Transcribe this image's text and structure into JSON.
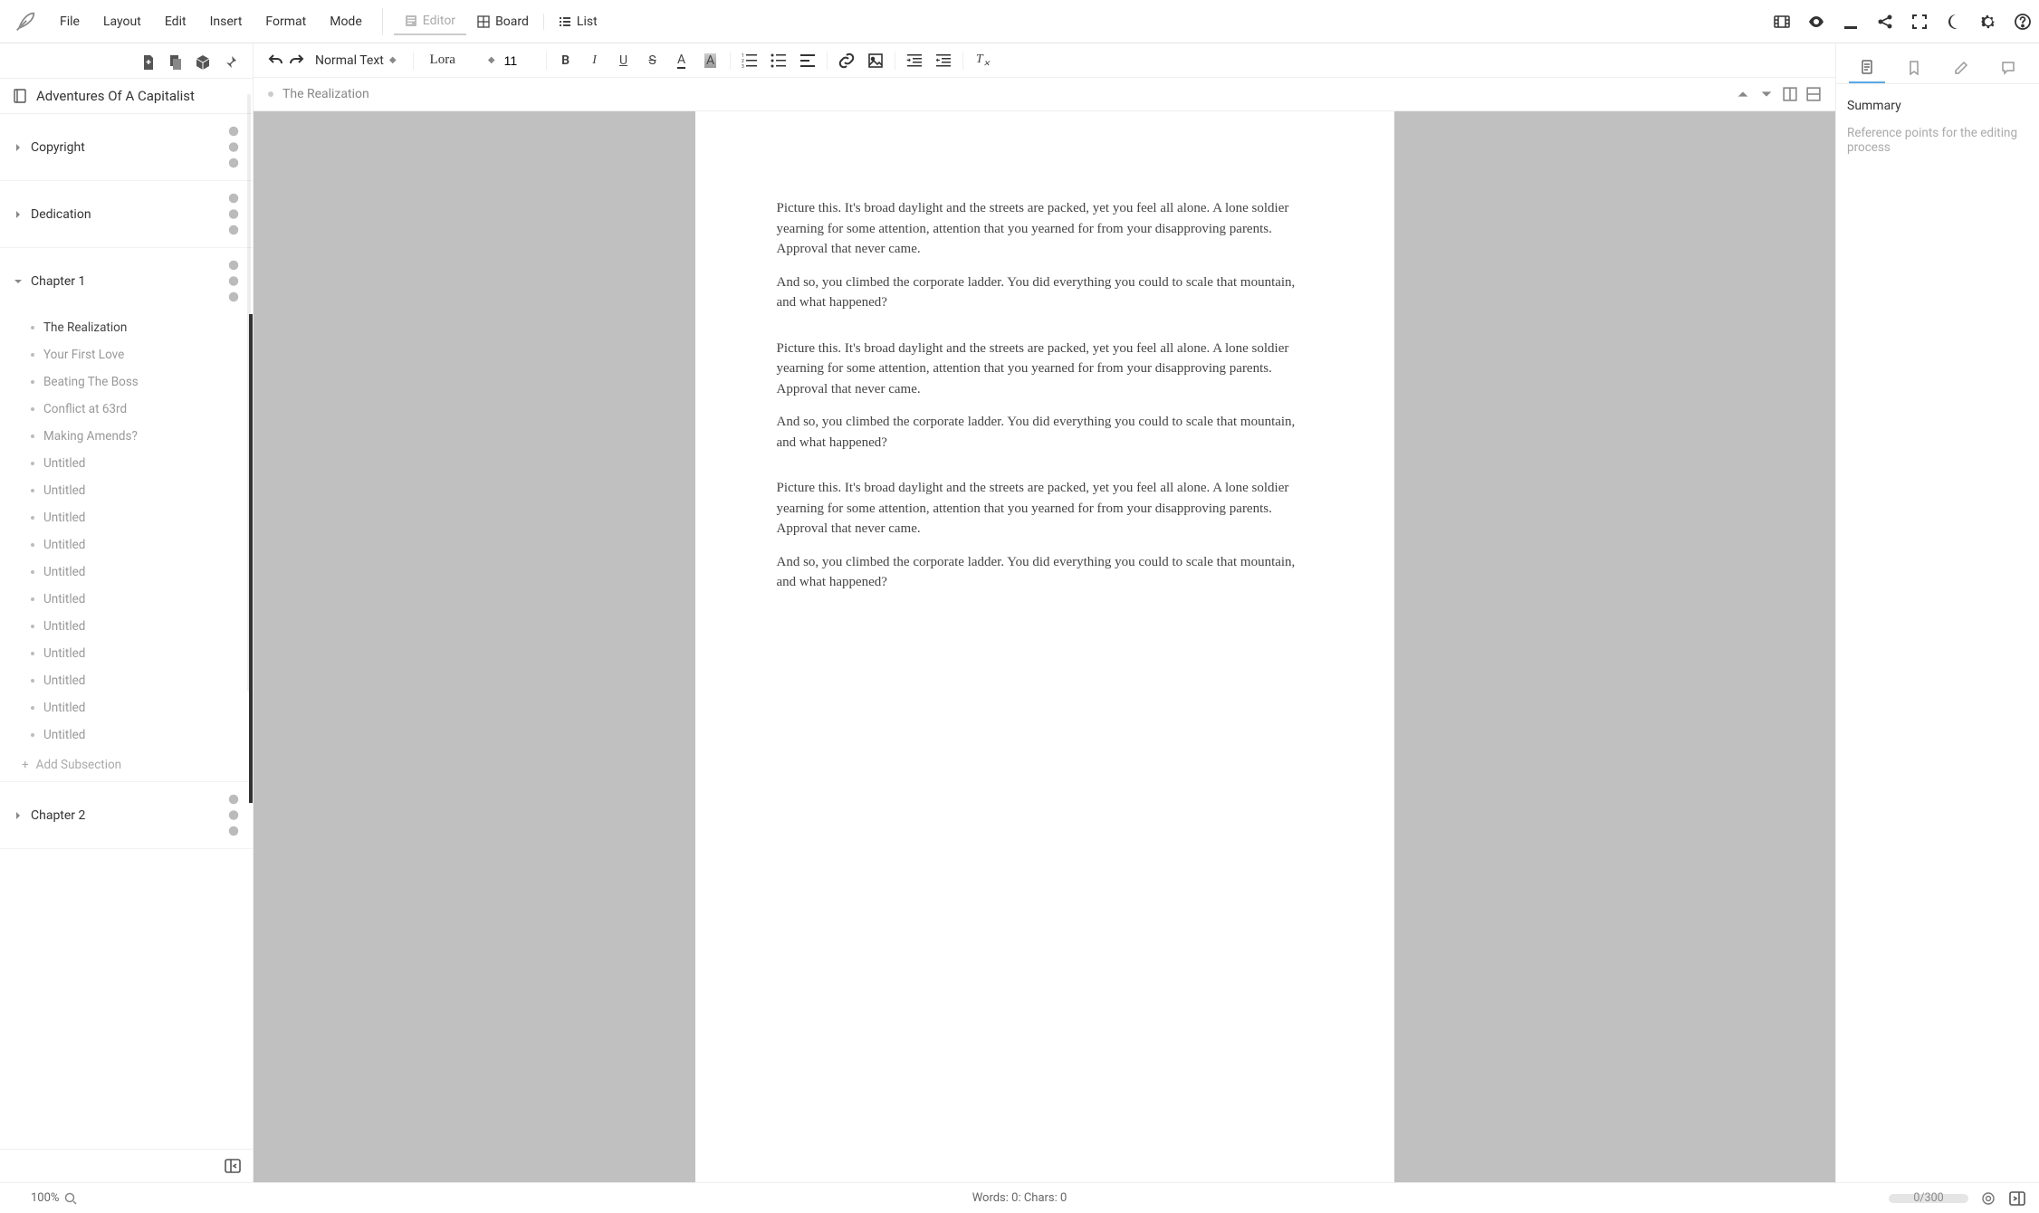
{
  "menu": {
    "items": [
      "File",
      "Layout",
      "Edit",
      "Insert",
      "Format",
      "Mode"
    ]
  },
  "view_tabs": [
    {
      "label": "Editor",
      "active": true
    },
    {
      "label": "Board",
      "active": false
    },
    {
      "label": "List",
      "active": false
    }
  ],
  "book": {
    "title": "Adventures Of A Capitalist"
  },
  "sections": [
    {
      "label": "Copyright",
      "open": false
    },
    {
      "label": "Dedication",
      "open": false
    },
    {
      "label": "Chapter 1",
      "open": true,
      "subs": [
        "The Realization",
        "Your First Love",
        "Beating The Boss",
        "Conflict at 63rd",
        "Making Amends?",
        "Untitled",
        "Untitled",
        "Untitled",
        "Untitled",
        "Untitled",
        "Untitled",
        "Untitled",
        "Untitled",
        "Untitled",
        "Untitled",
        "Untitled"
      ],
      "active_sub": 0
    },
    {
      "label": "Chapter 2",
      "open": false
    }
  ],
  "add_subsection": "Add Subsection",
  "toolbar": {
    "style": "Normal Text",
    "font": "Lora",
    "size": "11"
  },
  "document": {
    "title": "The Realization",
    "blocks": [
      {
        "p1": "Picture this. It's broad daylight and the streets are packed, yet you feel all alone. A lone soldier yearning for some attention, attention that you yearned for from your disapproving parents. Approval that never came.",
        "p2": "And so, you climbed the corporate ladder. You did everything you could to scale that mountain, and what happened?"
      },
      {
        "p1": "Picture this. It's broad daylight and the streets are packed, yet you feel all alone. A lone soldier yearning for some attention, attention that you yearned for from your disapproving parents. Approval that never came.",
        "p2": "And so, you climbed the corporate ladder. You did everything you could to scale that mountain, and what happened?"
      },
      {
        "p1": "Picture this. It's broad daylight and the streets are packed, yet you feel all alone. A lone soldier yearning for some attention, attention that you yearned for from your disapproving parents. Approval that never came.",
        "p2": "And so, you climbed the corporate ladder. You did everything you could to scale that mountain, and what happened?"
      }
    ]
  },
  "inspector": {
    "heading": "Summary",
    "placeholder": "Reference points for the editing process"
  },
  "status": {
    "zoom": "100%",
    "words_label": "Words: 0: Chars: 0",
    "progress": "0/300"
  }
}
